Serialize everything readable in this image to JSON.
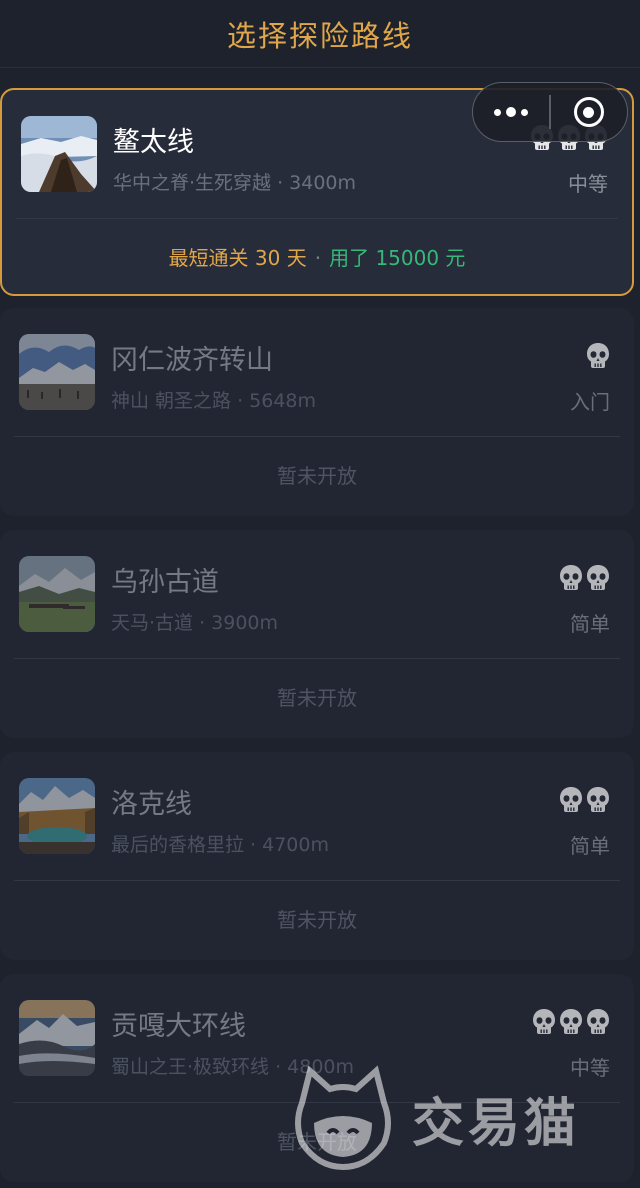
{
  "header": {
    "title": "选择探险路线"
  },
  "capsule": {
    "more_icon": "more-dots-icon",
    "close_icon": "target-circle-icon"
  },
  "routes": [
    {
      "name": "鳌太线",
      "meta": "华中之脊·生死穿越 · 3400m",
      "difficulty": "中等",
      "skulls": 3,
      "status": "active",
      "footer": {
        "best_label": "最短通关 30 天",
        "cost_label": "用了 15000 元",
        "separator": "·"
      },
      "thumb_theme": "ridge"
    },
    {
      "name": "冈仁波齐转山",
      "meta": "神山 朝圣之路 · 5648m",
      "difficulty": "入门",
      "skulls": 1,
      "status": "locked",
      "footer_text": "暂未开放",
      "thumb_theme": "kailash"
    },
    {
      "name": "乌孙古道",
      "meta": "天马·古道 · 3900m",
      "difficulty": "简单",
      "skulls": 2,
      "status": "locked",
      "footer_text": "暂未开放",
      "thumb_theme": "meadow"
    },
    {
      "name": "洛克线",
      "meta": "最后的香格里拉 · 4700m",
      "difficulty": "简单",
      "skulls": 2,
      "status": "locked",
      "footer_text": "暂未开放",
      "thumb_theme": "lake"
    },
    {
      "name": "贡嘎大环线",
      "meta": "蜀山之王·极致环线 · 4800m",
      "difficulty": "中等",
      "skulls": 3,
      "status": "locked",
      "footer_text": "暂未开放",
      "thumb_theme": "gongga"
    }
  ],
  "watermark": {
    "text": "交易猫",
    "icon": "cat-logo-icon"
  },
  "colors": {
    "background": "#1e222d",
    "card": "#262b38",
    "accent_gold": "#e0a64a",
    "accent_green": "#37b878",
    "active_border": "#d69a3d"
  }
}
